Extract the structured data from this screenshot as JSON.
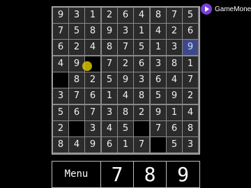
{
  "board": {
    "rows": [
      [
        "9",
        "3",
        "1",
        "2",
        "6",
        "4",
        "8",
        "7",
        "5"
      ],
      [
        "7",
        "5",
        "8",
        "9",
        "3",
        "1",
        "4",
        "2",
        "6"
      ],
      [
        "6",
        "2",
        "4",
        "8",
        "7",
        "5",
        "1",
        "3",
        "9"
      ],
      [
        "4",
        "9",
        "",
        "7",
        "2",
        "6",
        "3",
        "8",
        "1"
      ],
      [
        "",
        "8",
        "2",
        "5",
        "9",
        "3",
        "6",
        "4",
        "7"
      ],
      [
        "3",
        "7",
        "6",
        "1",
        "4",
        "8",
        "5",
        "9",
        "2"
      ],
      [
        "5",
        "6",
        "7",
        "3",
        "8",
        "2",
        "9",
        "1",
        "4"
      ],
      [
        "2",
        "",
        "3",
        "4",
        "5",
        "",
        "7",
        "6",
        "8"
      ],
      [
        "8",
        "4",
        "9",
        "6",
        "1",
        "7",
        "",
        "5",
        "3"
      ]
    ],
    "selected_cell": "row 3, column 9"
  },
  "controls": {
    "menu_label": "Menu",
    "numbers": [
      "7",
      "8",
      "9"
    ]
  },
  "badge": {
    "label": "GameMone"
  },
  "colors": {
    "selected_cell_bg": "#3d4a8a",
    "cell_bg": "#2b2b2b",
    "grid_line": "#8a8a8a",
    "box_line": "#cfcfcf",
    "badge_accent": "#7b3fd6"
  }
}
